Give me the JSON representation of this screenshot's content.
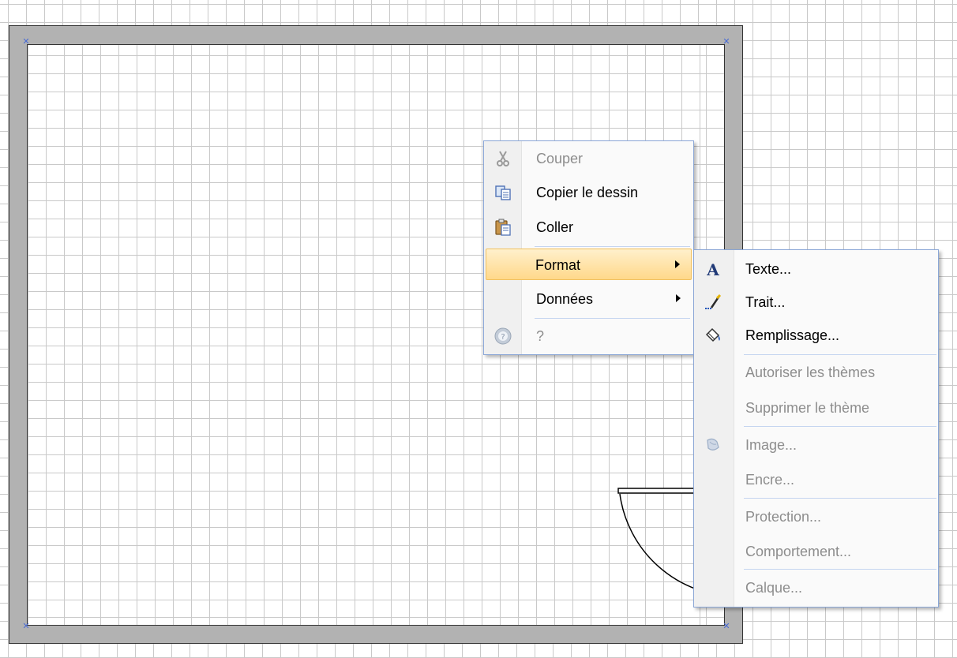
{
  "context_menu": {
    "items": [
      {
        "label": "Couper",
        "icon": "scissors-icon",
        "enabled": false
      },
      {
        "label": "Copier le dessin",
        "icon": "copy-icon",
        "enabled": true
      },
      {
        "label": "Coller",
        "icon": "paste-icon",
        "enabled": true
      },
      {
        "label": "Format",
        "enabled": true,
        "submenu": true,
        "highlighted": true
      },
      {
        "label": "Données",
        "enabled": true,
        "submenu": true
      },
      {
        "label": "?",
        "icon": "help-icon",
        "enabled": false
      }
    ]
  },
  "format_submenu": {
    "items": [
      {
        "label": "Texte...",
        "icon": "text-format-icon",
        "enabled": true
      },
      {
        "label": "Trait...",
        "icon": "line-brush-icon",
        "enabled": true
      },
      {
        "label": "Remplissage...",
        "icon": "fill-bucket-icon",
        "enabled": true
      },
      {
        "label": "Autoriser les thèmes",
        "enabled": false
      },
      {
        "label": "Supprimer le thème",
        "enabled": false
      },
      {
        "label": "Image...",
        "icon": "image-format-icon",
        "enabled": false
      },
      {
        "label": "Encre...",
        "enabled": false
      },
      {
        "label": "Protection...",
        "enabled": false
      },
      {
        "label": "Comportement...",
        "enabled": false
      },
      {
        "label": "Calque...",
        "enabled": false
      }
    ]
  },
  "colors": {
    "highlight": "#ffd88a",
    "menu_border": "#8aa6d6",
    "wall": "#b2b2b2",
    "selection_handle": "#4a6cd4"
  }
}
